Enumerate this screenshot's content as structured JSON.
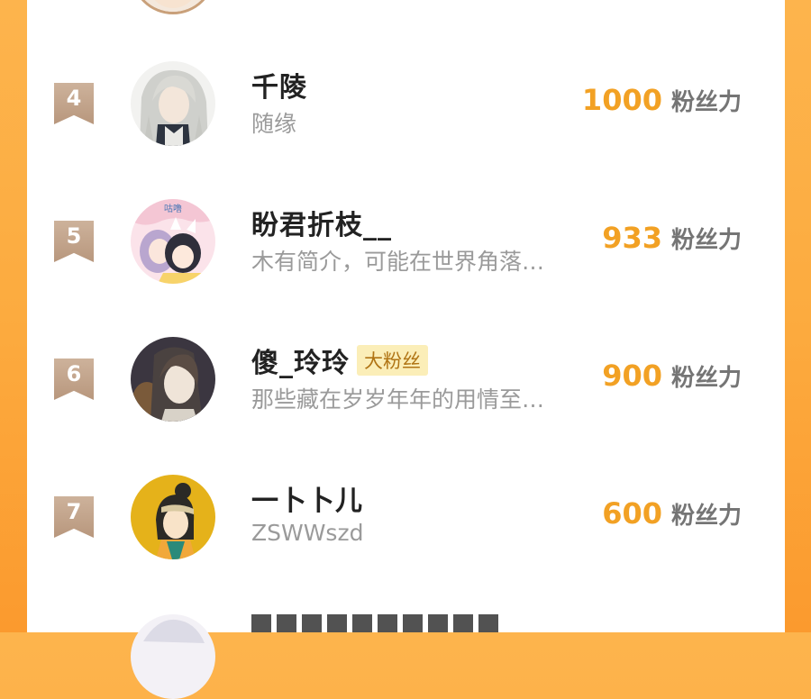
{
  "ranking": [
    {
      "rank": "4",
      "name": "千陵",
      "badge": "",
      "desc": "随缘",
      "score": "1000",
      "unit": "粉丝力",
      "avatar": "avatar-silver-hair-man"
    },
    {
      "rank": "5",
      "name": "盼君折枝__",
      "badge": "",
      "desc": "木有简介，可能在世界角落…",
      "score": "933",
      "unit": "粉丝力",
      "avatar": "avatar-anime-girls"
    },
    {
      "rank": "6",
      "name": "傻_玲玲",
      "badge": "大粉丝",
      "desc": "那些藏在岁岁年年的用情至…",
      "score": "900",
      "unit": "粉丝力",
      "avatar": "avatar-dark-hair-man"
    },
    {
      "rank": "7",
      "name": "一卜卜儿",
      "badge": "",
      "desc": "ZSWWszd",
      "score": "600",
      "unit": "粉丝力",
      "avatar": "avatar-yellow-girl"
    }
  ],
  "avatar_badge_text": "咕噜",
  "colors": {
    "background": "#fcab3f",
    "rank_flag": "#c2a58c",
    "score": "#f2a124",
    "badge_bg": "#fbeeb8"
  }
}
